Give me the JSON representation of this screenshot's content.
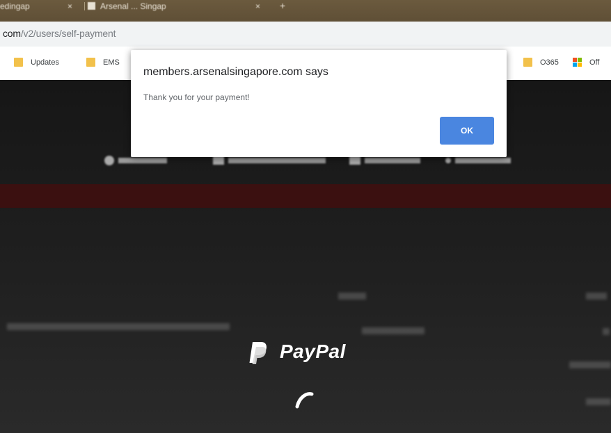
{
  "browser": {
    "tabs": [
      {
        "title": "edingap"
      },
      {
        "title": "Arsenal ... Singap"
      }
    ],
    "tab_close_glyph": "×",
    "new_tab_glyph": "+",
    "address": {
      "host": "com",
      "path": "/v2/users/self-payment"
    },
    "bookmarks": [
      {
        "label": "Updates",
        "icon": "folder-icon"
      },
      {
        "label": "EMS",
        "icon": "folder-icon"
      },
      {
        "label": "O365",
        "icon": "folder-icon"
      },
      {
        "label": "Off",
        "icon": "microsoft-logo-icon"
      }
    ]
  },
  "dialog": {
    "title": "members.arsenalsingapore.com says",
    "message": "Thank you for your payment!",
    "ok_label": "OK"
  },
  "paypal": {
    "wordmark": "PayPal"
  },
  "colors": {
    "accent_button": "#4a86e0",
    "tab_strip": "#6b5a3e",
    "page_background": "#1a1a1a",
    "page_band": "#3b1010",
    "folder": "#f2c14b"
  }
}
